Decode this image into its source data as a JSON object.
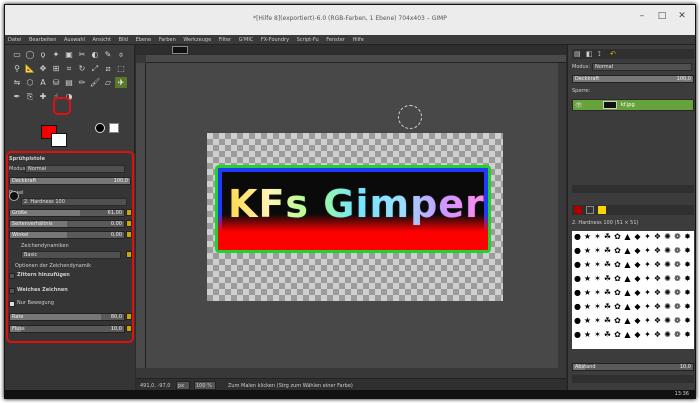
{
  "window": {
    "title": "*[Hilfe 8](exportiert)-6.0 (RGB-Farben, 1 Ebene) 704x403 – GIMP"
  },
  "menu": [
    "Datei",
    "Bearbeiten",
    "Auswahl",
    "Ansicht",
    "Bild",
    "Ebene",
    "Farben",
    "Werkzeuge",
    "Filter",
    "G'MIC",
    "FX-Foundry",
    "Script-Fu",
    "Fenster",
    "Hilfe"
  ],
  "toolbox": {
    "tool_icons": [
      "rect-select-icon",
      "ellipse-select-icon",
      "lasso-icon",
      "magic-wand-icon",
      "color-select-icon",
      "scissors-icon",
      "foreground-select-icon",
      "paths-icon",
      "color-picker-icon",
      "zoom-icon",
      "measure-icon",
      "move-icon",
      "align-icon",
      "crop-icon",
      "rotate-icon",
      "scale-icon",
      "shear-icon",
      "perspective-icon",
      "flip-icon",
      "cage-icon",
      "text-icon",
      "bucket-fill-icon",
      "blend-icon",
      "pencil-icon",
      "paintbrush-icon",
      "eraser-icon",
      "airbrush-icon",
      "ink-icon",
      "clone-icon",
      "heal-icon",
      "smudge-icon",
      "dodge-icon"
    ],
    "selected_tool": "airbrush-icon",
    "fg_color": "#f40000",
    "bg_color": "#ffffff"
  },
  "tool_options": {
    "header": "Sprühpistole",
    "mode_label": "Modus:",
    "mode_value": "Normal",
    "opacity_label": "Deckkraft",
    "opacity_value": "100,0",
    "brush_label": "Pinsel",
    "brush_name": "2. Hardness 100",
    "size_label": "Größe",
    "size_value": "61,00",
    "aspect_label": "Seitenverhältnis",
    "aspect_value": "0,00",
    "angle_label": "Winkel",
    "angle_value": "0,00",
    "dynamics_label": "Zeichendynamiken",
    "dynamics_value": "Basic",
    "dyn_options": "Optionen der Zeichendynamik",
    "jitter": "Zittern hinzufügen",
    "smooth": "Weiches Zeichnen",
    "motion_only": "Nur Bewegung",
    "rate_label": "Rate",
    "rate_value": "80,0",
    "flow_label": "Fluss",
    "flow_value": "10,0"
  },
  "canvas": {
    "text": "KFs Gimper",
    "status_coords": "491,0, -97,0",
    "status_unit": "px",
    "status_zoom": "100 %",
    "status_hint": "Zum Malen klicken (Strg zum Wählen einer Farbe)"
  },
  "layers": {
    "mode_label": "Modus:",
    "mode_value": "Normal",
    "opacity_label": "Deckkraft",
    "opacity_value": "100,0",
    "lock_label": "Sperre:",
    "layer_name": "kf.jpg"
  },
  "brushes": {
    "filter_label": "",
    "selected_brush": "2. Hardness 100 (51 × 51)",
    "spacing_label": "Abstand",
    "spacing_value": "10,0"
  },
  "taskbar": {
    "clock": "13:36"
  }
}
